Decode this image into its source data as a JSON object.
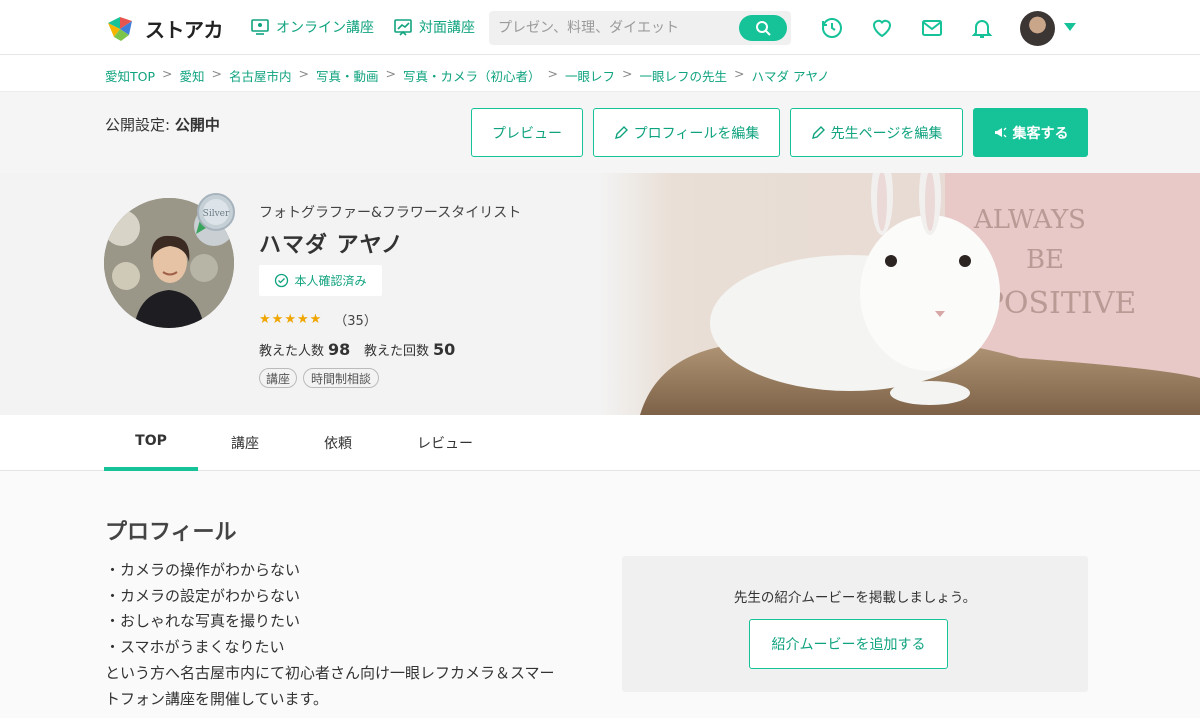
{
  "header": {
    "logo_text": "ストアカ",
    "nav_online": "オンライン講座",
    "nav_inperson": "対面講座",
    "search_placeholder": "プレゼン、料理、ダイエット"
  },
  "breadcrumb": [
    "愛知TOP",
    "愛知",
    "名古屋市内",
    "写真・動画",
    "写真・カメラ（初心者）",
    "一眼レフ",
    "一眼レフの先生",
    "ハマダ アヤノ"
  ],
  "publish": {
    "label": "公開設定:",
    "status": "公開中",
    "preview": "プレビュー",
    "edit_profile": "プロフィールを編集",
    "edit_teacher_page": "先生ページを編集",
    "promote": "集客する"
  },
  "profile": {
    "badge": "Silver",
    "subtitle": "フォトグラファー&フラワースタイリスト",
    "name": "ハマダ アヤノ",
    "verified": "本人確認済み",
    "rating": 5,
    "review_count": "（35）",
    "students_label": "教えた人数",
    "students": "98",
    "sessions_label": "教えた回数",
    "sessions": "50",
    "tags": [
      "講座",
      "時間制相談"
    ]
  },
  "hero_photo": {
    "text_line1": "ALWAYS",
    "text_line2": "BE",
    "text_line3": "POSITIVE"
  },
  "tabs": [
    "TOP",
    "講座",
    "依頼",
    "レビュー"
  ],
  "content": {
    "title": "プロフィール",
    "lines": [
      "・カメラの操作がわからない",
      "・カメラの設定がわからない",
      "・おしゃれな写真を撮りたい",
      "・スマホがうまくなりたい",
      "という方へ名古屋市内にて初心者さん向け一眼レフカメラ＆スマー",
      "トフォン講座を開催しています。"
    ],
    "video_message": "先生の紹介ムービーを掲載しましょう。",
    "video_button": "紹介ムービーを追加する"
  },
  "colors": {
    "accent": "#16c298",
    "accent_text": "#10a37f",
    "star": "#f0a500"
  }
}
